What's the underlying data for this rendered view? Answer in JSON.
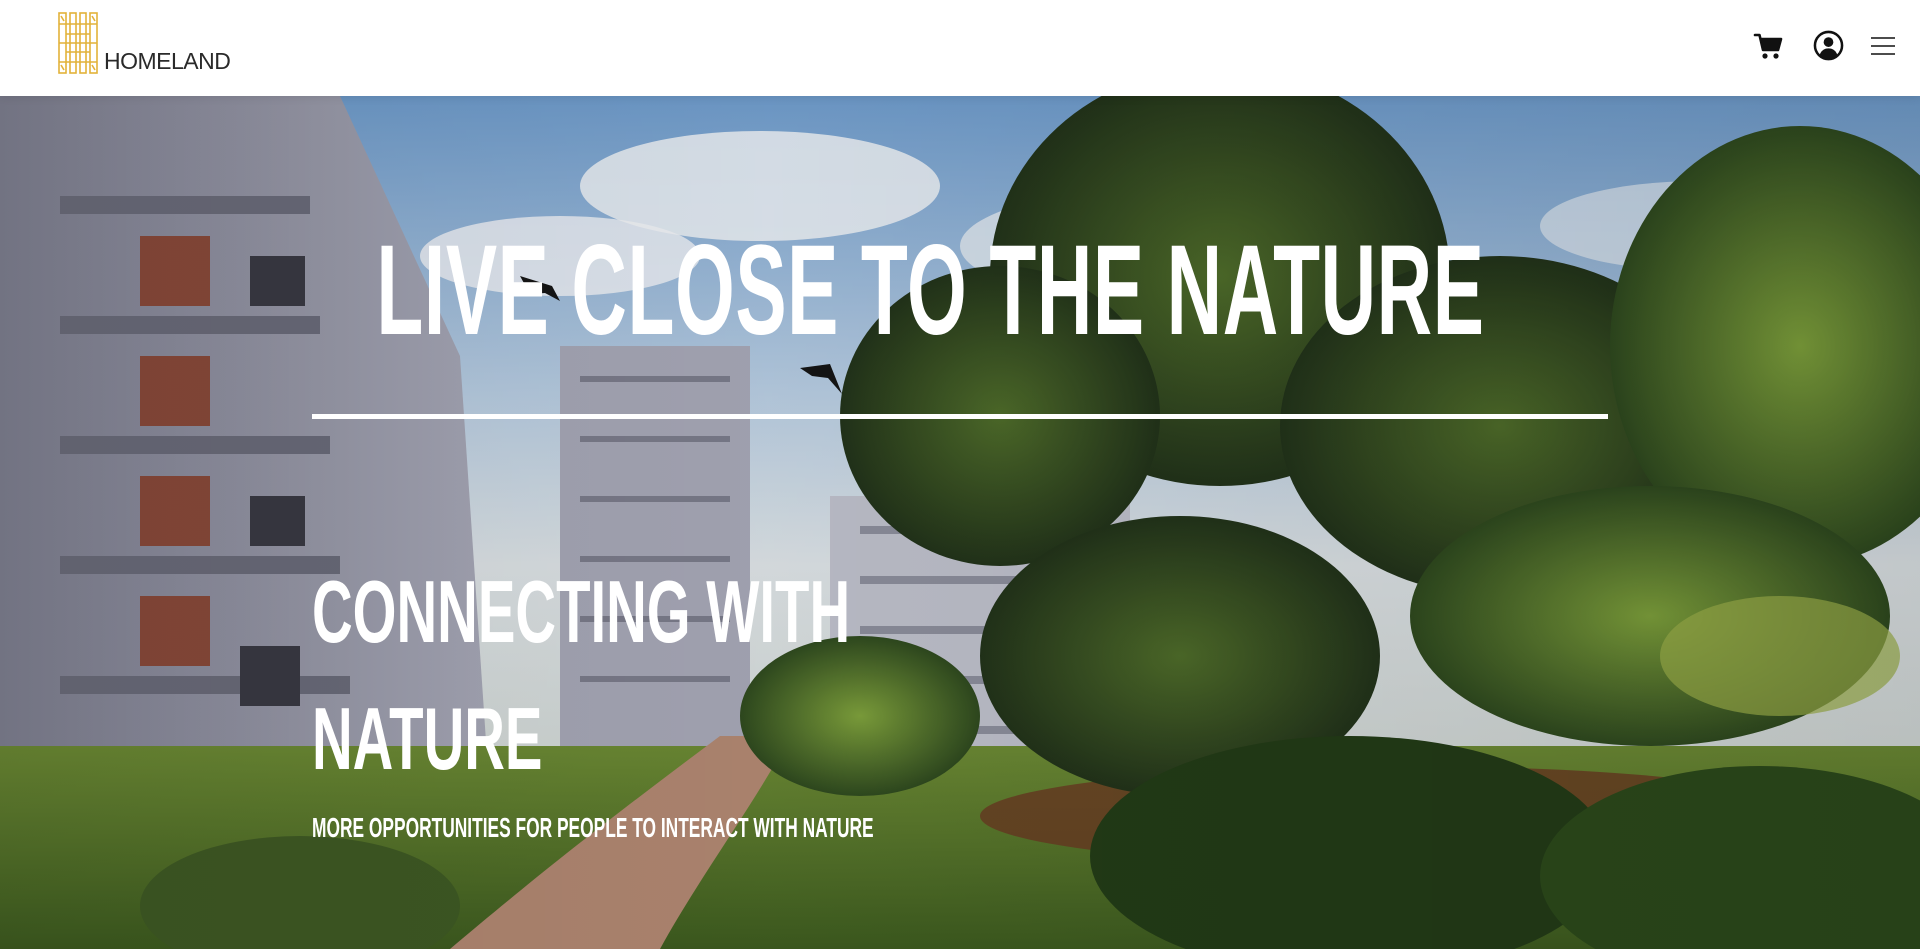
{
  "header": {
    "logo_text": "HOMELAND",
    "logo_color": "#e2b23a",
    "icons": {
      "cart": "cart-icon",
      "account": "account-icon",
      "menu": "menu-icon"
    }
  },
  "hero": {
    "title": "LIVE CLOSE TO THE NATURE",
    "subtitle_line1": "CONNECTING WITH",
    "subtitle_line2": "NATURE",
    "tagline": "MORE OPPORTUNITIES FOR PEOPLE TO INTERACT WITH NATURE",
    "text_color": "#ffffff"
  }
}
